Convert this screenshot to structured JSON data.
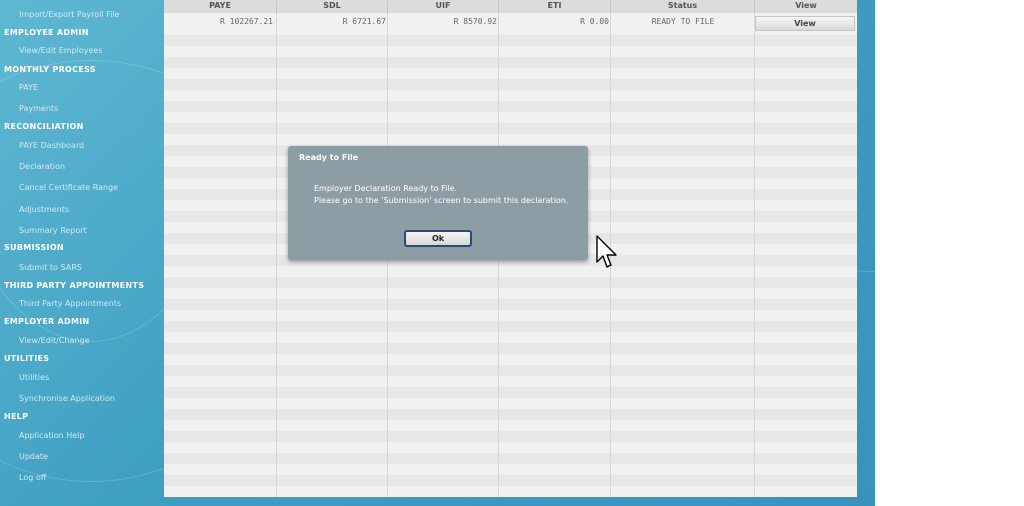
{
  "sidebar": {
    "items": [
      {
        "label": "Import/Export Payroll File",
        "kind": "link"
      },
      {
        "label": "EMPLOYEE ADMIN",
        "kind": "header"
      },
      {
        "label": "View/Edit Employees",
        "kind": "link"
      },
      {
        "label": "MONTHLY PROCESS",
        "kind": "header"
      },
      {
        "label": "PAYE",
        "kind": "link"
      },
      {
        "label": "Payments",
        "kind": "link"
      },
      {
        "label": "RECONCILIATION",
        "kind": "header"
      },
      {
        "label": "PAYE Dashboard",
        "kind": "link"
      },
      {
        "label": "Declaration",
        "kind": "link"
      },
      {
        "label": "Cancel Certificate Range",
        "kind": "link"
      },
      {
        "label": "Adjustments",
        "kind": "link"
      },
      {
        "label": "Summary Report",
        "kind": "link"
      },
      {
        "label": "SUBMISSION",
        "kind": "header"
      },
      {
        "label": "Submit to SARS",
        "kind": "link"
      },
      {
        "label": "THIRD PARTY APPOINTMENTS",
        "kind": "header"
      },
      {
        "label": "Third Party Appointments",
        "kind": "link"
      },
      {
        "label": "EMPLOYER ADMIN",
        "kind": "header"
      },
      {
        "label": "View/Edit/Change",
        "kind": "link"
      },
      {
        "label": "UTILITIES",
        "kind": "header"
      },
      {
        "label": "Utilities",
        "kind": "link"
      },
      {
        "label": "Synchronise Application",
        "kind": "link"
      },
      {
        "label": "HELP",
        "kind": "header"
      },
      {
        "label": "Application Help",
        "kind": "link"
      },
      {
        "label": "Update",
        "kind": "link"
      },
      {
        "label": "Log off",
        "kind": "link"
      }
    ]
  },
  "table": {
    "columns": [
      "PAYE",
      "SDL",
      "UIF",
      "ETI",
      "Status",
      "View"
    ],
    "rows": [
      {
        "paye": "R 102267.21",
        "sdl": "R 6721.67",
        "uif": "R 8570.92",
        "eti": "R 0.00",
        "status": "READY TO FILE",
        "view": "View"
      }
    ]
  },
  "dialog": {
    "title": "Ready to File",
    "line1": "Employer Declaration Ready to File.",
    "line2": "Please go to the 'Submission' screen to submit this declaration.",
    "ok_label": "Ok"
  },
  "colors": {
    "sidebar_bg": "#3f9fc2",
    "panel_bg": "#f1f1f1",
    "dialog_bg": "#8c9ea4",
    "ok_border": "#2a4a78"
  }
}
